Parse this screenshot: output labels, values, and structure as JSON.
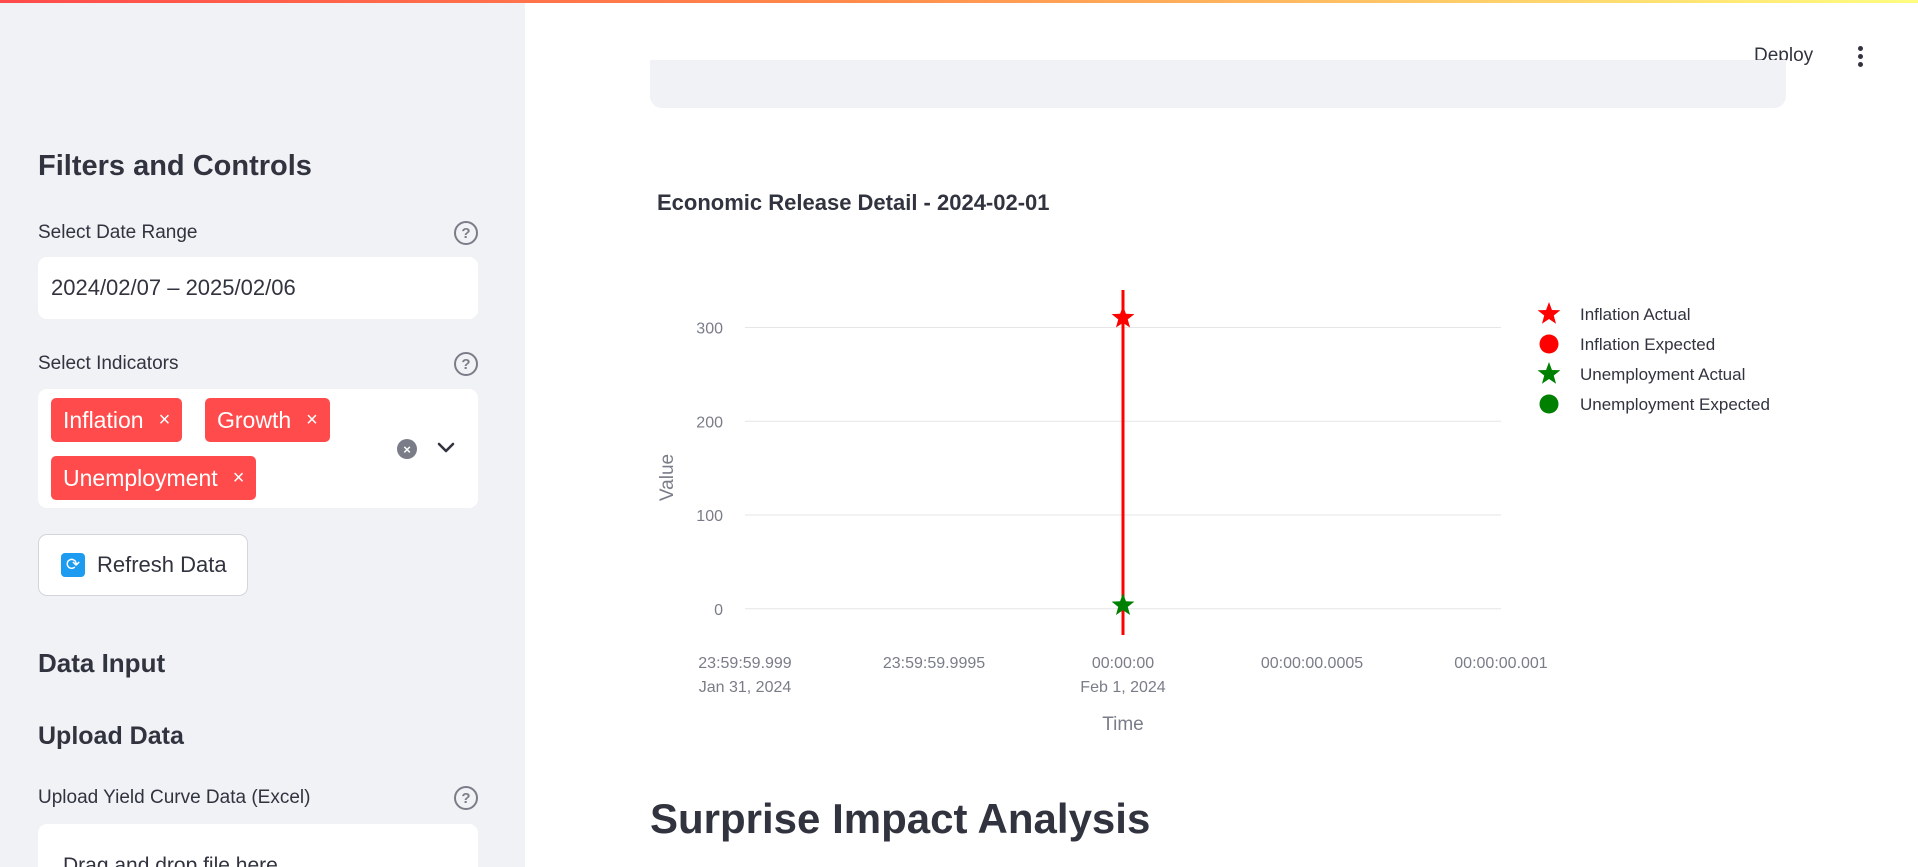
{
  "sidebar": {
    "filters_title": "Filters and Controls",
    "date_range": {
      "label": "Select Date Range",
      "value": "2024/02/07 – 2025/02/06"
    },
    "indicators": {
      "label": "Select Indicators",
      "chips": [
        "Inflation",
        "Growth",
        "Unemployment"
      ],
      "remove_glyph": "×"
    },
    "refresh_label": "Refresh Data",
    "data_input_title": "Data Input",
    "upload_title": "Upload Data",
    "upload_label": "Upload Yield Curve Data (Excel)",
    "dropzone_text": "Drag and drop file here"
  },
  "header": {
    "deploy_label": "Deploy"
  },
  "main": {
    "chart_title": "Economic Release Detail - 2024-02-01",
    "section_title": "Surprise Impact Analysis"
  },
  "colors": {
    "accent": "#ff4b4b",
    "inflation": "#ff0000",
    "unemployment": "#008000",
    "sidebar_bg": "#f0f2f6"
  },
  "icons": [
    "help-icon",
    "close-icon",
    "clear-icon",
    "chevron-down-icon",
    "refresh-icon",
    "kebab-menu-icon",
    "star-marker-icon",
    "circle-marker-icon"
  ],
  "chart_data": {
    "type": "scatter",
    "title": "Economic Release Detail - 2024-02-01",
    "xlabel": "Time",
    "ylabel": "Value",
    "ylim": [
      -28,
      340
    ],
    "x_ticks": [
      {
        "line1": "23:59:59.999",
        "line2": "Jan 31, 2024"
      },
      {
        "line1": "23:59:59.9995",
        "line2": ""
      },
      {
        "line1": "00:00:00",
        "line2": "Feb 1, 2024"
      },
      {
        "line1": "00:00:00.0005",
        "line2": ""
      },
      {
        "line1": "00:00:00.001",
        "line2": ""
      }
    ],
    "y_ticks": [
      0,
      100,
      200,
      300
    ],
    "grid": true,
    "legend": "right",
    "vertical_line": {
      "x": "2024-02-01 00:00:00",
      "color": "#ff0000"
    },
    "series": [
      {
        "name": "Inflation Actual",
        "marker": "star",
        "color": "#ff0000",
        "points": [
          {
            "x": "2024-02-01 00:00:00",
            "y": 310.3
          }
        ]
      },
      {
        "name": "Inflation Expected",
        "marker": "circle",
        "color": "#ff0000",
        "points": []
      },
      {
        "name": "Unemployment Actual",
        "marker": "star",
        "color": "#008000",
        "points": [
          {
            "x": "2024-02-01 00:00:00",
            "y": 3.7
          }
        ]
      },
      {
        "name": "Unemployment Expected",
        "marker": "circle",
        "color": "#008000",
        "points": []
      }
    ]
  }
}
